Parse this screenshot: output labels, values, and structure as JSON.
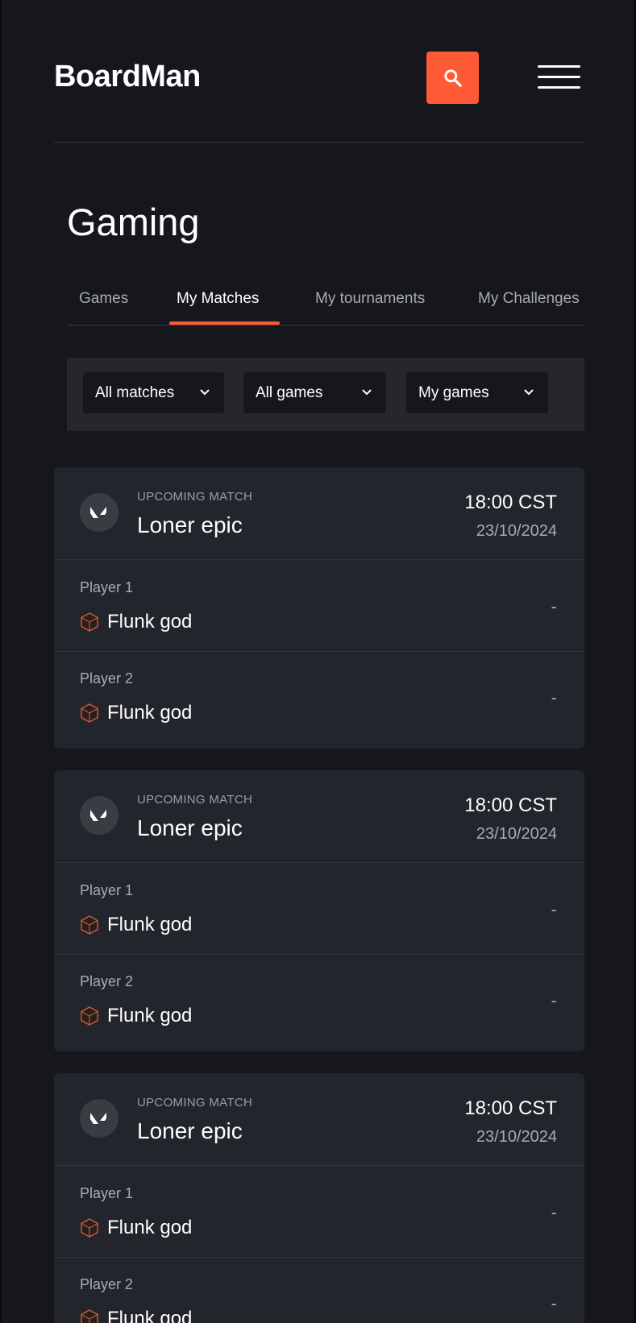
{
  "header": {
    "logo": "BoardMan",
    "search_icon": "search-icon",
    "menu_icon": "hamburger-menu-icon",
    "accent_color": "#ff5a36"
  },
  "page": {
    "title": "Gaming"
  },
  "tabs": [
    {
      "label": "Games",
      "active": false
    },
    {
      "label": "My Matches",
      "active": true
    },
    {
      "label": "My tournaments",
      "active": false
    },
    {
      "label": "My Challenges",
      "active": false
    }
  ],
  "filters": [
    {
      "value": "All matches",
      "icon": "chevron-down-icon"
    },
    {
      "value": "All games",
      "icon": "chevron-down-icon"
    },
    {
      "value": "My games",
      "icon": "chevron-down-icon"
    }
  ],
  "matches": [
    {
      "status": "UPCOMING MATCH",
      "name": "Loner epic",
      "time": "18:00 CST",
      "date": "23/10/2024",
      "game_icon": "valorant-logo-icon",
      "players": [
        {
          "label": "Player 1",
          "name": "Flunk god",
          "score": "-"
        },
        {
          "label": "Player 2",
          "name": "Flunk god",
          "score": "-"
        }
      ]
    },
    {
      "status": "UPCOMING MATCH",
      "name": "Loner epic",
      "time": "18:00 CST",
      "date": "23/10/2024",
      "game_icon": "valorant-logo-icon",
      "players": [
        {
          "label": "Player 1",
          "name": "Flunk god",
          "score": "-"
        },
        {
          "label": "Player 2",
          "name": "Flunk god",
          "score": "-"
        }
      ]
    },
    {
      "status": "UPCOMING MATCH",
      "name": "Loner epic",
      "time": "18:00 CST",
      "date": "23/10/2024",
      "game_icon": "valorant-logo-icon",
      "players": [
        {
          "label": "Player 1",
          "name": "Flunk god",
          "score": "-"
        },
        {
          "label": "Player 2",
          "name": "Flunk god",
          "score": "-"
        }
      ]
    }
  ]
}
